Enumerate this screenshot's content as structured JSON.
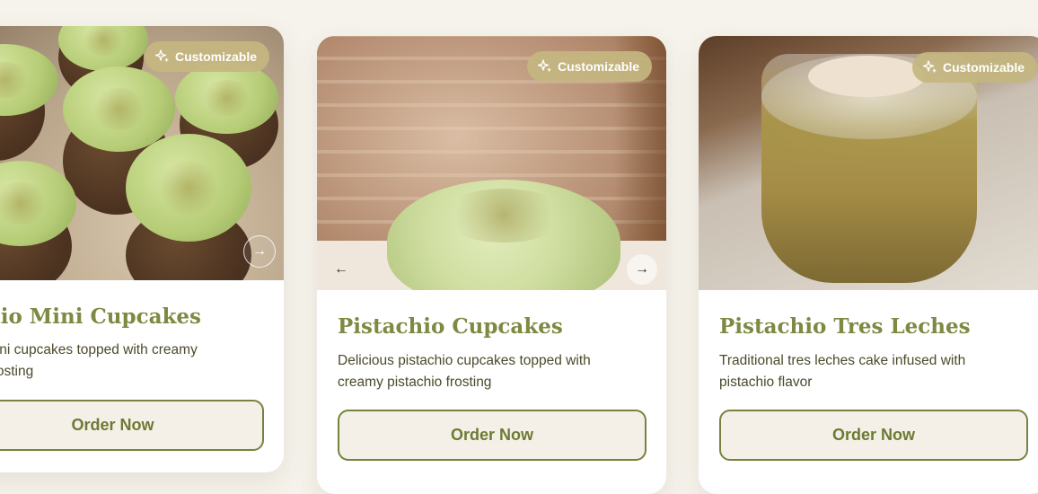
{
  "products": [
    {
      "title": "Pistachio Mini Cupcakes",
      "title_visible": "chio Mini Cupcakes",
      "description_line1": "e mini cupcakes topped with creamy",
      "description_line2": "io frosting",
      "badge": "Customizable",
      "button": "Order Now",
      "image_icon": "mini-cupcakes-photo"
    },
    {
      "title": "Pistachio Cupcakes",
      "description_line1": "Delicious pistachio cupcakes topped with",
      "description_line2": "creamy pistachio frosting",
      "badge": "Customizable",
      "button": "Order Now",
      "image_icon": "pistachio-cupcake-photo"
    },
    {
      "title": "Pistachio Tres Leches",
      "description_line1": "Traditional tres leches cake infused with",
      "description_line2": "pistachio flavor",
      "badge": "Customizable",
      "button": "Order Now",
      "image_icon": "tres-leches-cup-photo"
    }
  ],
  "controls": {
    "prev_icon": "arrow-left-icon",
    "next_icon": "arrow-right-icon",
    "prev_glyph": "←",
    "next_glyph": "→"
  },
  "colors": {
    "background": "#f6f3ec",
    "title": "#7c8a42",
    "button_border": "#77823f",
    "button_bg": "#f5f0e7",
    "badge": "#c4b680"
  }
}
